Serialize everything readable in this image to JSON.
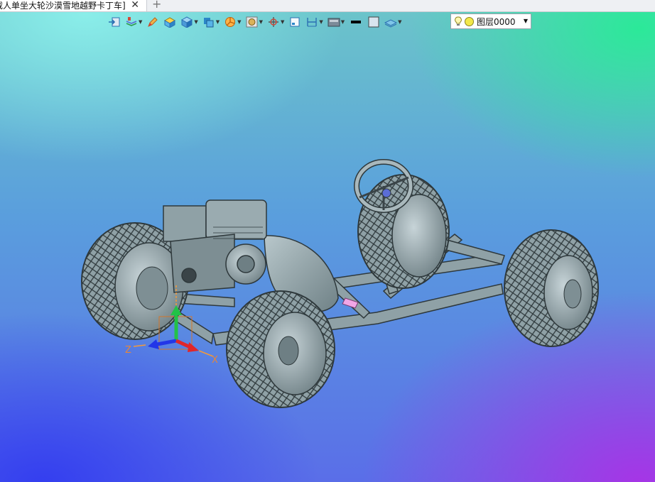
{
  "window": {
    "tab_title": "载人单坐大轮沙漠雪地越野卡丁车]",
    "close_glyph": "✕",
    "new_tab_glyph": "+"
  },
  "toolbar": {
    "icons": [
      "import-icon",
      "layers-manager-icon",
      "pen-icon",
      "box-solid-icon",
      "cube-icon",
      "view-cube-icon",
      "section-icon",
      "render-icon",
      "snap-icon",
      "frame-icon",
      "dimension-icon",
      "display-icon",
      "color-black-icon",
      "color-square-icon",
      "plane-icon"
    ],
    "layer_selector": {
      "value": "图层0000",
      "bulb_color": "#f2e84a"
    }
  },
  "axes": {
    "z_label": "Z",
    "x_label": "X"
  },
  "colors": {
    "model": "#8fa1a6",
    "model_dark": "#3a4448",
    "accent": "#ff9a3a"
  }
}
